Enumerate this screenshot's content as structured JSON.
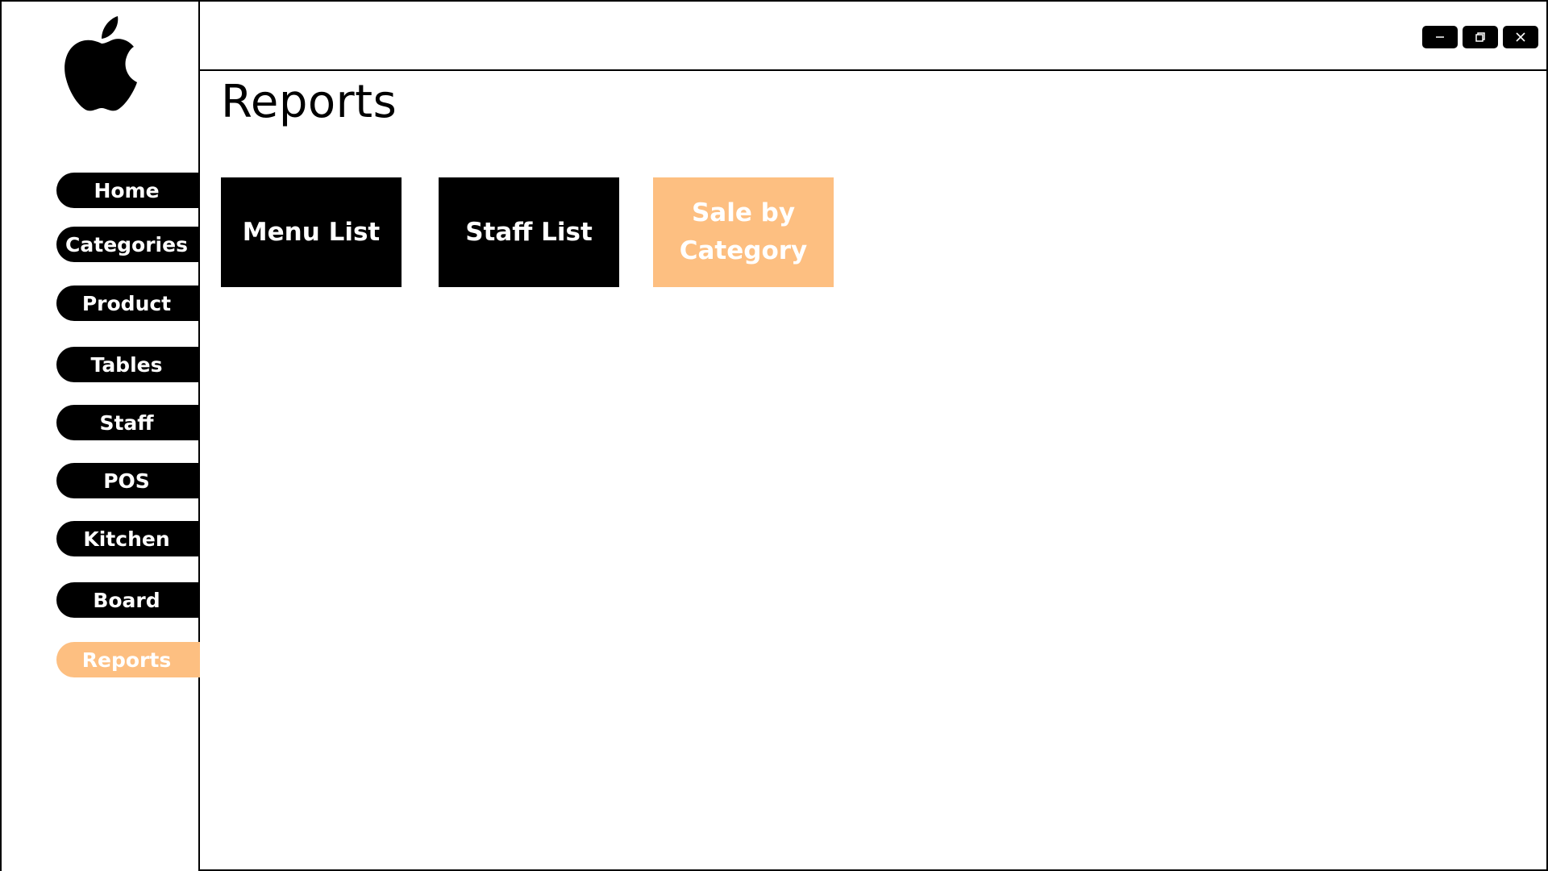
{
  "window": {
    "controls": {
      "minimize_icon": "minimize-icon",
      "restore_icon": "restore-icon",
      "close_icon": "close-icon"
    }
  },
  "sidebar": {
    "logo_icon": "apple-logo-icon",
    "items": [
      {
        "label": "Home",
        "active": false
      },
      {
        "label": "Categories",
        "active": false
      },
      {
        "label": "Product",
        "active": false
      },
      {
        "label": "Tables",
        "active": false
      },
      {
        "label": "Staff",
        "active": false
      },
      {
        "label": "POS",
        "active": false
      },
      {
        "label": "Kitchen",
        "active": false
      },
      {
        "label": "Board",
        "active": false
      },
      {
        "label": "Reports",
        "active": true
      }
    ]
  },
  "main": {
    "title": "Reports",
    "tiles": [
      {
        "label": "Menu List",
        "active": false
      },
      {
        "label": "Staff List",
        "active": false
      },
      {
        "label": "Sale by Category",
        "active": true
      }
    ]
  },
  "colors": {
    "primary": "#000000",
    "accent": "#fdbf81",
    "background": "#ffffff",
    "text_on_dark": "#ffffff"
  }
}
